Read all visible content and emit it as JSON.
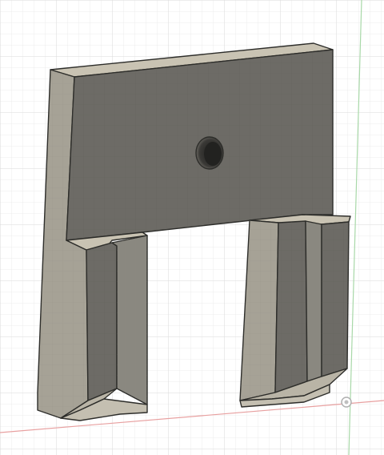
{
  "viewport": {
    "view_mode": "3d-model-viewport",
    "background_color": "#ffffff",
    "grid_minor_color": "#ececec",
    "grid_major_color": "#d8d8d8",
    "axis_x_color": "#e8a0a0",
    "axis_y_color": "#a8d8a8",
    "origin_marker_color": "#c8c8c8"
  },
  "model": {
    "material_colors": {
      "front_face": "#6d6b66",
      "top_face": "#c9c3b3",
      "left_side_face": "#a6a296",
      "inner_face": "#8a8880",
      "edge_line": "#2d2d2a"
    },
    "features": [
      "mounting-hole",
      "left-leg",
      "right-leg",
      "slot-groove"
    ]
  }
}
